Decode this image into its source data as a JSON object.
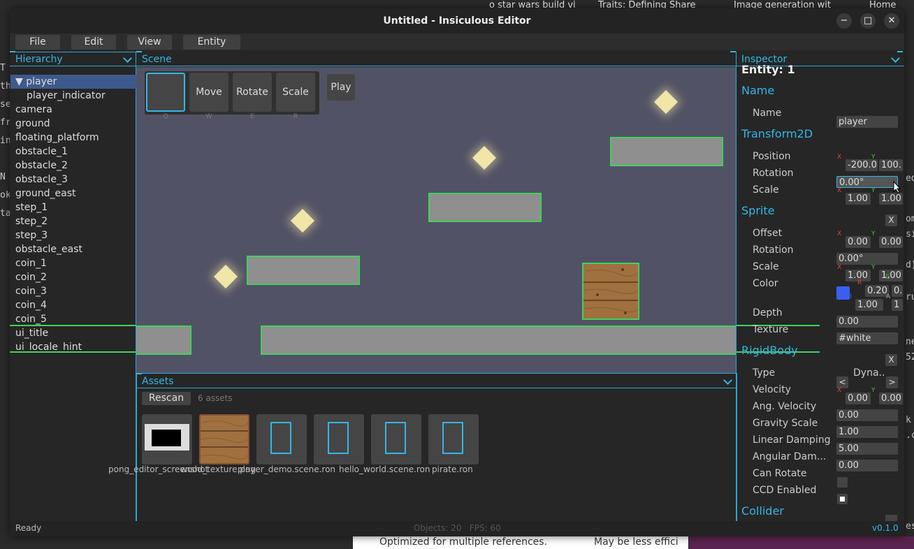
{
  "background": {
    "tabs": [
      "o star wars build vi",
      "Traits: Defining Share",
      "Image generation wit",
      "Home"
    ],
    "left_text": [
      "T",
      "th",
      "se",
      "fr",
      "in",
      "N",
      "ok",
      "ta"
    ],
    "right_text": [
      "ed",
      "om",
      "si",
      "d)",
      "ru",
      "ne",
      "52",
      "k",
      ".c",
      "es"
    ],
    "bottom_text": [
      "Optimized for multiple references.",
      "May be less effici"
    ]
  },
  "window": {
    "title": "Untitled - Insiculous Editor",
    "minimize": "−",
    "maximize": "□",
    "close": "✕"
  },
  "menubar": [
    "File",
    "Edit",
    "View",
    "Entity"
  ],
  "hierarchy": {
    "title": "Hierarchy",
    "items": [
      {
        "label": "▼ player",
        "selected": true,
        "indent": 0
      },
      {
        "label": "player_indicator",
        "indent": 1
      },
      {
        "label": "camera",
        "indent": 0
      },
      {
        "label": "ground",
        "indent": 0
      },
      {
        "label": "floating_platform",
        "indent": 0
      },
      {
        "label": "obstacle_1",
        "indent": 0
      },
      {
        "label": "obstacle_2",
        "indent": 0
      },
      {
        "label": "obstacle_3",
        "indent": 0
      },
      {
        "label": "ground_east",
        "indent": 0
      },
      {
        "label": "step_1",
        "indent": 0
      },
      {
        "label": "step_2",
        "indent": 0
      },
      {
        "label": "step_3",
        "indent": 0
      },
      {
        "label": "obstacle_east",
        "indent": 0
      },
      {
        "label": "coin_1",
        "indent": 0
      },
      {
        "label": "coin_2",
        "indent": 0
      },
      {
        "label": "coin_3",
        "indent": 0
      },
      {
        "label": "coin_4",
        "indent": 0
      },
      {
        "label": "coin_5",
        "indent": 0
      },
      {
        "label": "ui_title",
        "indent": 0
      },
      {
        "label": "ui_locale_hint",
        "indent": 0
      }
    ]
  },
  "scene": {
    "title": "Scene",
    "tools": [
      {
        "label": "",
        "key": "Q",
        "active": true
      },
      {
        "label": "Move",
        "key": "W"
      },
      {
        "label": "Rotate",
        "key": "E"
      },
      {
        "label": "Scale",
        "key": "R"
      }
    ],
    "play": "Play"
  },
  "assets": {
    "title": "Assets",
    "rescan": "Rescan",
    "count": "6 assets",
    "items": [
      "pong_editor_screenshot",
      "wood_texture.png",
      "player_demo.scene.ron",
      "hello_world.scene.ron",
      "pirate.ron",
      ""
    ]
  },
  "inspector": {
    "title": "Inspector",
    "entity": "Entity: 1",
    "sections": {
      "name": "Name",
      "transform": "Transform2D",
      "sprite": "Sprite",
      "rigidbody": "RigidBody",
      "collider": "Collider"
    },
    "name_label": "Name",
    "name_value": "player",
    "transform": {
      "position_label": "Position",
      "position_x": "-200.0",
      "position_y": "100.",
      "rotation_label": "Rotation",
      "rotation": "0.00°",
      "scale_label": "Scale",
      "scale_x": "1.00",
      "scale_y": "1.00"
    },
    "sprite": {
      "remove": "X",
      "offset_label": "Offset",
      "offset_x": "0.00",
      "offset_y": "0.00",
      "rotation_label": "Rotation",
      "rotation": "0.00°",
      "scale_label": "Scale",
      "scale_x": "1.00",
      "scale_y": "1.00",
      "color_label": "Color",
      "color_swatch": "#3a5ff0",
      "color_r": "0.20",
      "color_g": "0.",
      "color_b": "1.00",
      "color_a": "1",
      "depth_label": "Depth",
      "depth": "0.00",
      "texture_label": "Texture",
      "texture": "#white"
    },
    "rigidbody": {
      "remove": "X",
      "type_label": "Type",
      "type_value": "Dyna..",
      "prev": "<",
      "next": ">",
      "velocity_label": "Velocity",
      "velocity_x": "0.00",
      "velocity_y": "0.00",
      "ang_velocity_label": "Ang. Velocity",
      "ang_velocity": "0.00",
      "gravity_label": "Gravity Scale",
      "gravity": "1.00",
      "linear_damping_label": "Linear Damping",
      "linear_damping": "5.00",
      "angular_damping_label": "Angular Dam...",
      "angular_damping": "0.00",
      "can_rotate_label": "Can Rotate",
      "can_rotate": false,
      "ccd_label": "CCD Enabled",
      "ccd": true
    },
    "axis": {
      "x": "X",
      "y": "Y",
      "r": "R",
      "g": "G",
      "b": "B",
      "a": "A"
    }
  },
  "statusbar": {
    "left": "Ready",
    "center": "Objects: 20   FPS: 60",
    "right": "v0.1.0"
  },
  "colors": {
    "accent": "#35b6e6",
    "selection": "#3d5a8c",
    "collider": "#3fd35a",
    "scene_bg": "#525266"
  }
}
